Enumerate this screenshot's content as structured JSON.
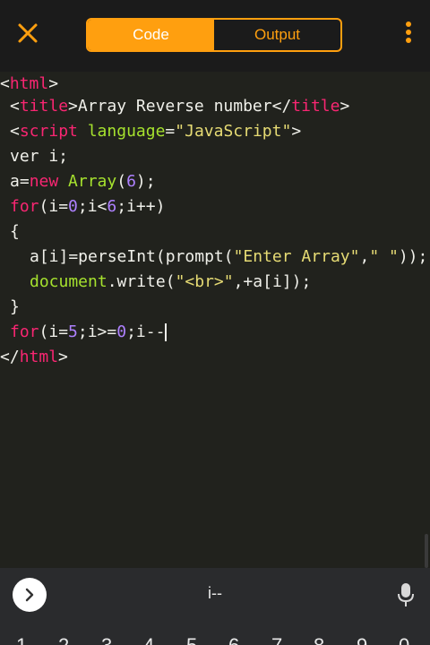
{
  "tabs": {
    "code": "Code",
    "output": "Output"
  },
  "code_lines": {
    "l1": {
      "lt": "<",
      "tag": "html",
      "gt": ">"
    },
    "l2": {
      "lt": "<",
      "tag": "title",
      "mid": ">Array Reverse number</",
      "tag2": "title",
      "gt": ">"
    },
    "l3": {
      "lt": "<",
      "tag": "script",
      "sp": " ",
      "attr": "language",
      "eq": "=",
      "str": "\"JavaScript\"",
      "gt": ">"
    },
    "l4": {
      "text": "ver i;"
    },
    "l5": {
      "a": "a=",
      "kw": "new",
      "sp": " ",
      "fn": "Array",
      "p1": "(",
      "num": "6",
      "p2": ");"
    },
    "l6": {
      "kw": "for",
      "p1": "(i=",
      "n1": "0",
      "p2": ";i<",
      "n2": "6",
      "p3": ";i++)"
    },
    "l7": {
      "text": "{"
    },
    "l8": {
      "a": "a[i]=perseInt(prompt(",
      "s1": "\"Enter Array\"",
      "c": ",",
      "s2": "\" \"",
      "e": "));"
    },
    "l9": {
      "fn": "document",
      "d": ".write(",
      "s1": "\"<br>\"",
      "e": ",+a[i]);"
    },
    "l10": {
      "text": "}"
    },
    "l11": {
      "kw": "for",
      "p1": "(i=",
      "n1": "5",
      "p2": ";i>=",
      "n2": "0",
      "p3": ";i--"
    },
    "l12": {
      "lt": "</",
      "tag": "html",
      "gt": ">"
    }
  },
  "keyboard": {
    "suggestion": "i--",
    "digits": [
      "1",
      "2",
      "3",
      "4",
      "5",
      "6",
      "7",
      "8",
      "9",
      "0"
    ]
  },
  "colors": {
    "accent": "#ff9f0f",
    "editor_bg": "#21221d",
    "tag": "#f92672",
    "string": "#e6db74",
    "number": "#ae81ff",
    "function": "#a6e22e"
  },
  "icons": {
    "close": "close-icon",
    "more": "more-vertical-icon",
    "arrow": "chevron-right-icon",
    "mic": "microphone-icon"
  }
}
